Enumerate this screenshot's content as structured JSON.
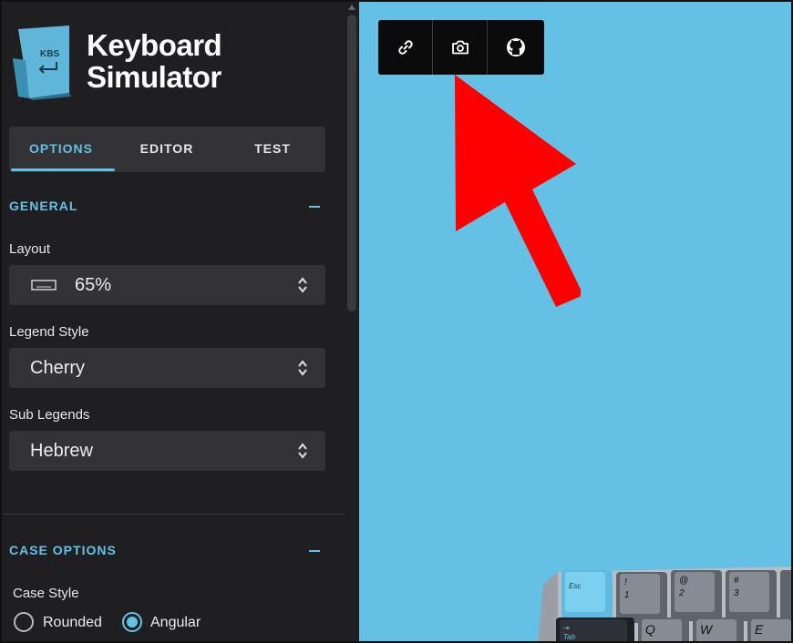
{
  "app": {
    "logo_text": "KBS",
    "title_line1": "Keyboard",
    "title_line2": "Simulator"
  },
  "tabs": [
    {
      "label": "OPTIONS",
      "active": true
    },
    {
      "label": "EDITOR",
      "active": false
    },
    {
      "label": "TEST",
      "active": false
    }
  ],
  "general": {
    "heading": "GENERAL",
    "layout_label": "Layout",
    "layout_value": "65%",
    "legend_label": "Legend Style",
    "legend_value": "Cherry",
    "sublegend_label": "Sub Legends",
    "sublegend_value": "Hebrew"
  },
  "case_options": {
    "heading": "CASE OPTIONS",
    "case_style_label": "Case Style",
    "options": [
      {
        "label": "Rounded",
        "selected": false
      },
      {
        "label": "Angular",
        "selected": true
      }
    ]
  },
  "toolbar": {
    "icons": [
      "link-icon",
      "camera-icon",
      "github-icon"
    ]
  },
  "keyboard_keys": [
    "Esc",
    "!",
    "@",
    "#",
    "1",
    "2",
    "3",
    "Tab",
    "Q",
    "W",
    "E"
  ],
  "colors": {
    "accent": "#65c1e6",
    "sidebar_bg": "#1f1f22",
    "panel_bg": "#333336",
    "canvas_bg": "#64c1e5",
    "annotation_arrow": "#ff0000"
  }
}
